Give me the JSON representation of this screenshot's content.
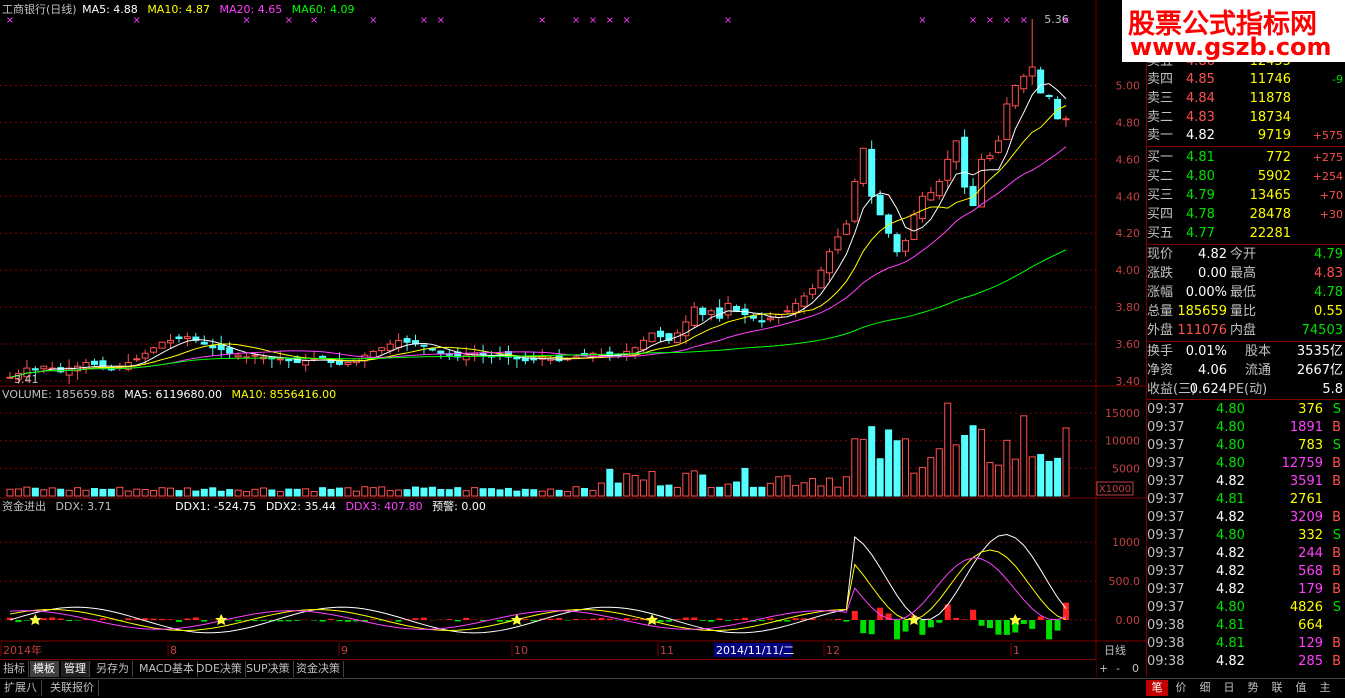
{
  "main_header": {
    "title": "工商银行(日线)",
    "ma5": "MA5: 4.88",
    "ma10": "MA10: 4.87",
    "ma20": "MA20: 4.65",
    "ma60": "MA60: 4.09",
    "colors": {
      "ma5": "#ffffff",
      "ma10": "#ffff00",
      "ma20": "#ff40ff",
      "ma60": "#00ff00"
    }
  },
  "vol_header": {
    "volume": "VOLUME: 185659.88",
    "ma5": "MA5: 6119680.00",
    "ma10": "MA10: 8556416.00"
  },
  "ddx_header": {
    "title": "资金进出",
    "ddx": "DDX: 3.71",
    "ddx1": "DDX1: -524.75",
    "ddx2": "DDX2: 35.44",
    "ddx3": "DDX3: 407.80",
    "warn": "预警: 0.00"
  },
  "price_axis": [
    "5.00",
    "4.80",
    "4.60",
    "4.40",
    "4.20",
    "4.00",
    "3.80",
    "3.60",
    "3.40"
  ],
  "vol_axis": [
    "15000",
    "10000",
    "5000"
  ],
  "vol_unit": "X1000",
  "ddx_axis": [
    "1000",
    "500.0",
    "0.00"
  ],
  "high_label": "5.36",
  "low_label": "3.41",
  "date_axis": {
    "start": "2014年",
    "m8": "8",
    "m9": "9",
    "m10": "10",
    "m11": "11",
    "cursor": "2014/11/11/二",
    "m12": "12",
    "m1": "1",
    "right": "日线"
  },
  "tabs": [
    "指标",
    "模板",
    "管理",
    "另存为",
    "MACD基本",
    "DDE决策",
    "SUP决策",
    "资金决策"
  ],
  "bottom_tabs": [
    "扩展八",
    "关联报价"
  ],
  "right_tabs": [
    "笔",
    "价",
    "细",
    "日",
    "势",
    "联",
    "值",
    "主"
  ],
  "zoom": [
    "+",
    "-",
    "0"
  ],
  "watermark": {
    "line1": "股票公式指标网",
    "line2": "www.gszb.com"
  },
  "orderbook": {
    "sell": [
      {
        "label": "卖五",
        "price": "4.86",
        "vol": "12455",
        "chg": ""
      },
      {
        "label": "卖四",
        "price": "4.85",
        "vol": "11746",
        "chg": "-9"
      },
      {
        "label": "卖三",
        "price": "4.84",
        "vol": "11878",
        "chg": ""
      },
      {
        "label": "卖二",
        "price": "4.83",
        "vol": "18734",
        "chg": ""
      },
      {
        "label": "卖一",
        "price": "4.82",
        "vol": "9719",
        "chg": "+575"
      }
    ],
    "buy": [
      {
        "label": "买一",
        "price": "4.81",
        "vol": "772",
        "chg": "+275"
      },
      {
        "label": "买二",
        "price": "4.80",
        "vol": "5902",
        "chg": "+254"
      },
      {
        "label": "买三",
        "price": "4.79",
        "vol": "13465",
        "chg": "+70"
      },
      {
        "label": "买四",
        "price": "4.78",
        "vol": "28478",
        "chg": "+30"
      },
      {
        "label": "买五",
        "price": "4.77",
        "vol": "22281",
        "chg": ""
      }
    ]
  },
  "quote": [
    {
      "l1": "现价",
      "v1": "4.82",
      "l2": "今开",
      "v2": "4.79"
    },
    {
      "l1": "涨跌",
      "v1": "0.00",
      "l2": "最高",
      "v2": "4.83"
    },
    {
      "l1": "涨幅",
      "v1": "0.00%",
      "l2": "最低",
      "v2": "4.78"
    },
    {
      "l1": "总量",
      "v1": "185659",
      "l2": "量比",
      "v2": "0.55"
    },
    {
      "l1": "外盘",
      "v1": "111076",
      "l2": "内盘",
      "v2": "74503"
    }
  ],
  "fund": [
    {
      "l1": "换手",
      "v1": "0.01%",
      "l2": "股本",
      "v2": "3535亿"
    },
    {
      "l1": "净资",
      "v1": "4.06",
      "l2": "流通",
      "v2": "2667亿"
    },
    {
      "l1": "收益(三)",
      "v1": "0.624",
      "l2": "PE(动)",
      "v2": "5.8"
    }
  ],
  "ticks": [
    {
      "t": "09:37",
      "p": "4.80",
      "v": "376",
      "s": "S"
    },
    {
      "t": "09:37",
      "p": "4.80",
      "v": "1891",
      "s": "B"
    },
    {
      "t": "09:37",
      "p": "4.80",
      "v": "783",
      "s": "S"
    },
    {
      "t": "09:37",
      "p": "4.80",
      "v": "12759",
      "s": "B"
    },
    {
      "t": "09:37",
      "p": "4.82",
      "v": "3591",
      "s": "B"
    },
    {
      "t": "09:37",
      "p": "4.81",
      "v": "2761",
      "s": ""
    },
    {
      "t": "09:37",
      "p": "4.82",
      "v": "3209",
      "s": "B"
    },
    {
      "t": "09:37",
      "p": "4.80",
      "v": "332",
      "s": "S"
    },
    {
      "t": "09:37",
      "p": "4.82",
      "v": "244",
      "s": "B"
    },
    {
      "t": "09:37",
      "p": "4.82",
      "v": "568",
      "s": "B"
    },
    {
      "t": "09:37",
      "p": "4.82",
      "v": "179",
      "s": "B"
    },
    {
      "t": "09:37",
      "p": "4.80",
      "v": "4826",
      "s": "S"
    },
    {
      "t": "09:38",
      "p": "4.81",
      "v": "664",
      "s": ""
    },
    {
      "t": "09:38",
      "p": "4.81",
      "v": "129",
      "s": "B"
    },
    {
      "t": "09:38",
      "p": "4.82",
      "v": "285",
      "s": "B"
    }
  ],
  "chart_data": {
    "type": "candlestick",
    "title": "工商银行(日线)",
    "ylim": [
      3.4,
      5.36
    ],
    "series": [
      {
        "name": "MA5",
        "last": 4.88
      },
      {
        "name": "MA10",
        "last": 4.87
      },
      {
        "name": "MA20",
        "last": 4.65
      },
      {
        "name": "MA60",
        "last": 4.09
      }
    ],
    "closes": [
      3.42,
      3.44,
      3.47,
      3.46,
      3.48,
      3.47,
      3.45,
      3.47,
      3.48,
      3.5,
      3.49,
      3.47,
      3.46,
      3.48,
      3.5,
      3.52,
      3.55,
      3.58,
      3.61,
      3.62,
      3.63,
      3.64,
      3.62,
      3.6,
      3.58,
      3.57,
      3.55,
      3.54,
      3.53,
      3.54,
      3.53,
      3.52,
      3.52,
      3.51,
      3.5,
      3.51,
      3.52,
      3.53,
      3.5,
      3.49,
      3.5,
      3.52,
      3.54,
      3.56,
      3.58,
      3.6,
      3.62,
      3.61,
      3.6,
      3.59,
      3.57,
      3.55,
      3.54,
      3.53,
      3.54,
      3.55,
      3.54,
      3.53,
      3.54,
      3.53,
      3.52,
      3.51,
      3.52,
      3.53,
      3.52,
      3.51,
      3.52,
      3.53,
      3.54,
      3.55,
      3.54,
      3.53,
      3.54,
      3.56,
      3.58,
      3.62,
      3.66,
      3.64,
      3.62,
      3.66,
      3.72,
      3.8,
      3.76,
      3.78,
      3.74,
      3.82,
      3.78,
      3.76,
      3.74,
      3.72,
      3.74,
      3.76,
      3.78,
      3.82,
      3.86,
      3.9,
      4.0,
      4.1,
      4.18,
      4.25,
      4.48,
      4.66,
      4.4,
      4.3,
      4.2,
      4.1,
      4.16,
      4.3,
      4.4,
      4.42,
      4.48,
      4.6,
      4.7,
      4.45,
      4.35,
      4.6,
      4.62,
      4.7,
      4.9,
      5.0,
      5.05,
      5.1,
      4.96,
      4.94,
      4.82,
      4.82
    ],
    "volume_unit": "X1000",
    "volume_ylim": [
      0,
      17000
    ],
    "ddx_ylim": [
      -450,
      1350
    ]
  }
}
